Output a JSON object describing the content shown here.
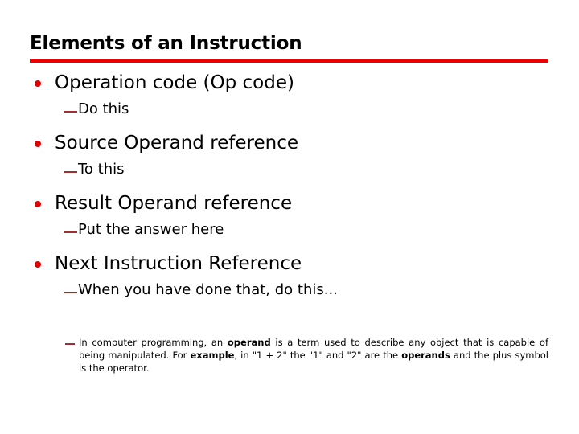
{
  "slide": {
    "title": "Elements of an Instruction",
    "accent_color": "#ee0000",
    "bullet_color": "#e00000",
    "dash_color": "#a03030",
    "text_color": "#000000",
    "background_color": "#ffffff",
    "bullets": [
      {
        "text": "Operation code (Op code)",
        "sub": "Do this"
      },
      {
        "text": "Source Operand reference",
        "sub": "To this"
      },
      {
        "text": "Result Operand reference",
        "sub": "Put the answer here"
      },
      {
        "text": "Next Instruction Reference",
        "sub": "When you have done that, do this..."
      }
    ],
    "note": {
      "part1": "In computer programming, an ",
      "bold1": "operand",
      "part2": " is a term used to describe any object that is capable of being manipulated. For ",
      "bold2": "example",
      "part3": ", in \"1 + 2\" the \"1\" and \"2\" are the ",
      "bold3": "operands",
      "part4": " and the plus symbol is the operator."
    }
  }
}
